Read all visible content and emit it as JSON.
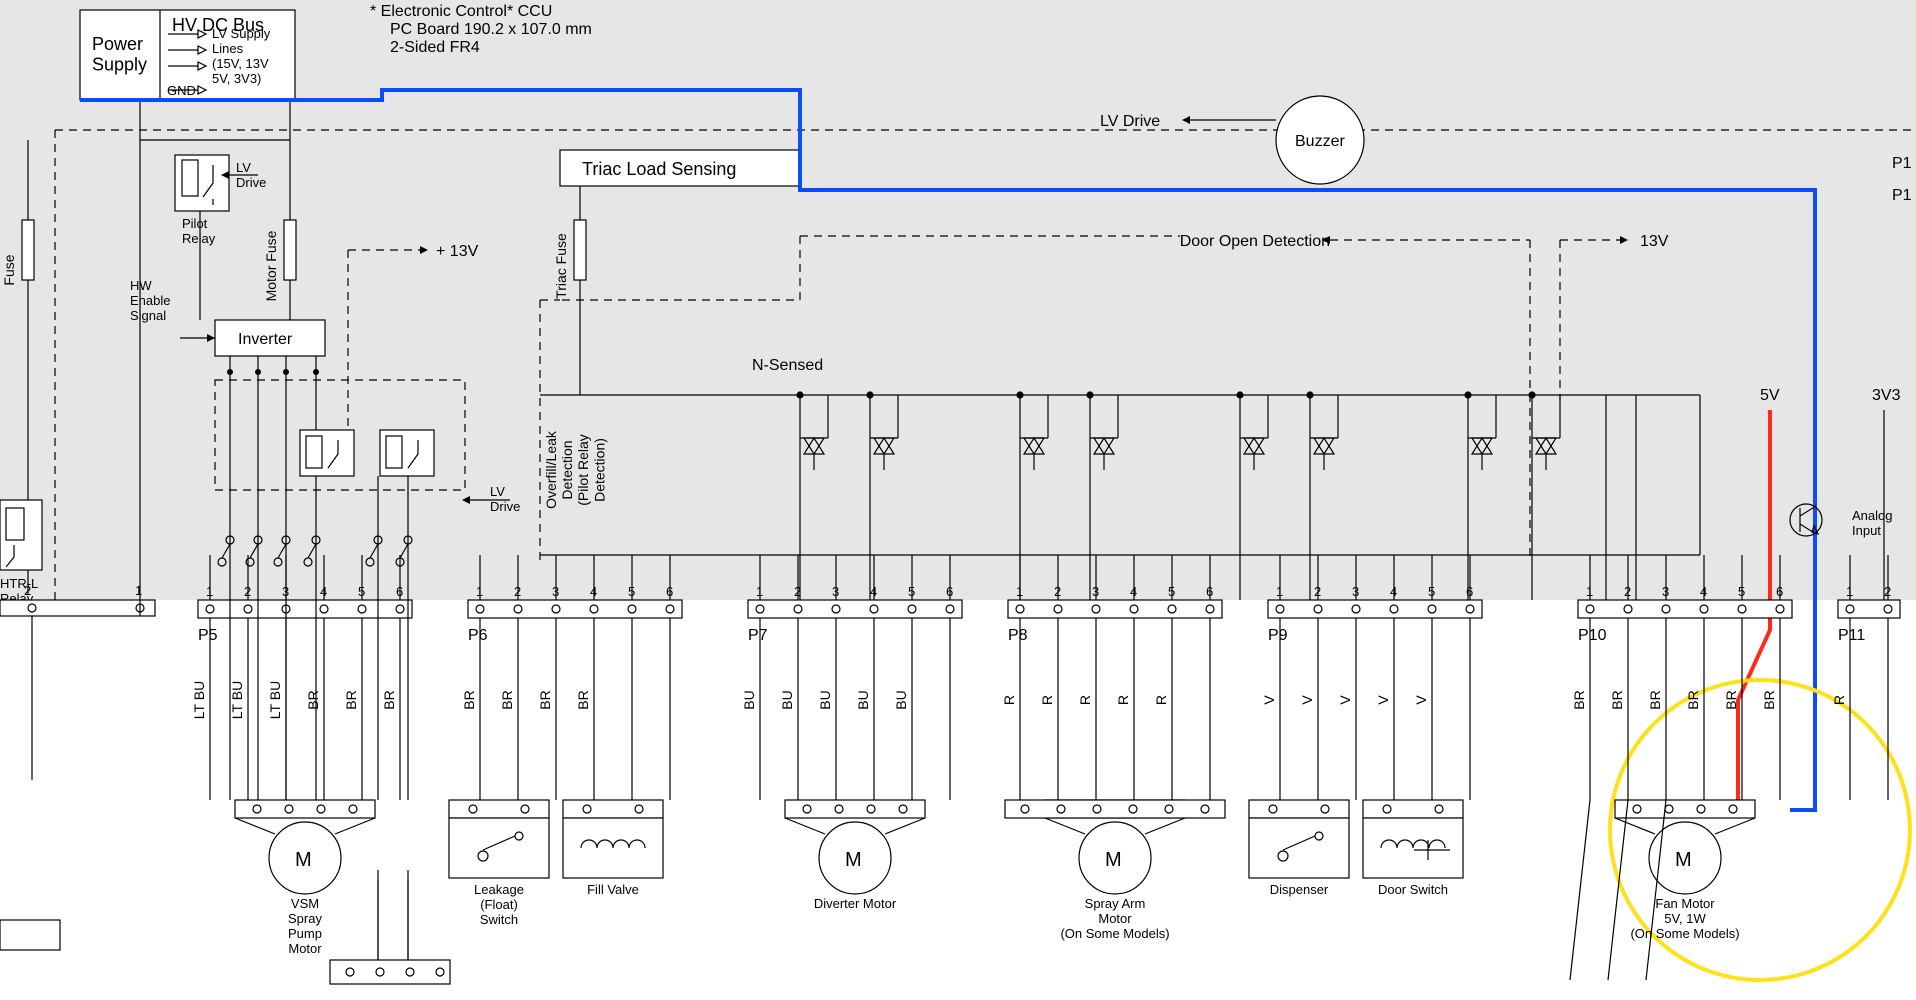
{
  "header": {
    "hv_bus": "HV DC Bus",
    "ccu1": "*  Electronic Control* CCU",
    "ccu2": "PC Board 190.2 x 107.0 mm",
    "ccu3": "2-Sided FR4",
    "power_supply": "Power\nSupply",
    "lv_supply": "LV Supply\nLines\n(15V, 13V\n5V, 3V3)",
    "gnd": "GND"
  },
  "labels": {
    "fuse": "Fuse",
    "motor_fuse": "Motor Fuse",
    "triac_fuse": "Triac Fuse",
    "pilot_relay": "Pilot\nRelay",
    "lv_drive": "LV\nDrive",
    "inverter": "Inverter",
    "hw_enable": "HW\nEnable\nSignal",
    "p13v": "+ 13V",
    "triac_load": "Triac Load Sensing",
    "lv_drive2": "LV\nDrive",
    "overfill": "Overfill/Leak\nDetection\n(Pilot Relay\nDetection)",
    "nsensed": "N-Sensed",
    "lv_drive_top": "LV Drive",
    "buzzer": "Buzzer",
    "door_open": "Door Open Detection",
    "v13": "13V",
    "v5": "5V",
    "v3v3": "3V3",
    "analog": "Analog\nInput",
    "p1a": "P1",
    "p1b": "P1",
    "htr_relay": "HTR-L\nRelay",
    "term2": "2",
    "term1": "1"
  },
  "connectors": [
    {
      "name": "P5",
      "pins": [
        "1",
        "2",
        "3",
        "4",
        "5",
        "6"
      ],
      "wires": [
        "LT BU",
        "LT BU",
        "LT BU",
        "BR",
        "BR",
        "BR"
      ],
      "device": "VSM\nSpray\nPump\nMotor",
      "type": "motor"
    },
    {
      "name": "P6",
      "pins": [
        "1",
        "2",
        "3",
        "4",
        "5",
        "6"
      ],
      "wires": [
        "BR",
        "BR",
        "BR",
        "BR",
        "",
        ""
      ],
      "device": "",
      "type": "split",
      "left": "Leakage\n(Float)\nSwitch",
      "right": "Fill Valve"
    },
    {
      "name": "P7",
      "pins": [
        "1",
        "2",
        "3",
        "4",
        "5",
        "6"
      ],
      "wires": [
        "BU",
        "BU",
        "BU",
        "BU",
        "BU",
        ""
      ],
      "device": "Diverter Motor",
      "type": "motor"
    },
    {
      "name": "P8",
      "pins": [
        "1",
        "2",
        "3",
        "4",
        "5",
        "6"
      ],
      "wires": [
        "R",
        "R",
        "R",
        "R",
        "R",
        ""
      ],
      "device": "Spray Arm\nMotor\n(On Some Models)",
      "type": "motor"
    },
    {
      "name": "P9",
      "pins": [
        "1",
        "2",
        "3",
        "4",
        "5",
        "6"
      ],
      "wires": [
        "V",
        "V",
        "V",
        "V",
        "V",
        ""
      ],
      "device": "",
      "type": "split",
      "left": "Dispenser",
      "right": "Door Switch"
    },
    {
      "name": "P10",
      "pins": [
        "1",
        "2",
        "3",
        "4",
        "5",
        "6"
      ],
      "wires": [
        "BR",
        "BR",
        "BR",
        "BR",
        "BR",
        "BR"
      ],
      "device": "Fan Motor\n5V, 1W\n(On Some Models)",
      "type": "motor"
    },
    {
      "name": "P11",
      "pins": [
        "1",
        "2"
      ],
      "wires": [
        "R",
        ""
      ],
      "device": "",
      "type": "stub"
    }
  ]
}
